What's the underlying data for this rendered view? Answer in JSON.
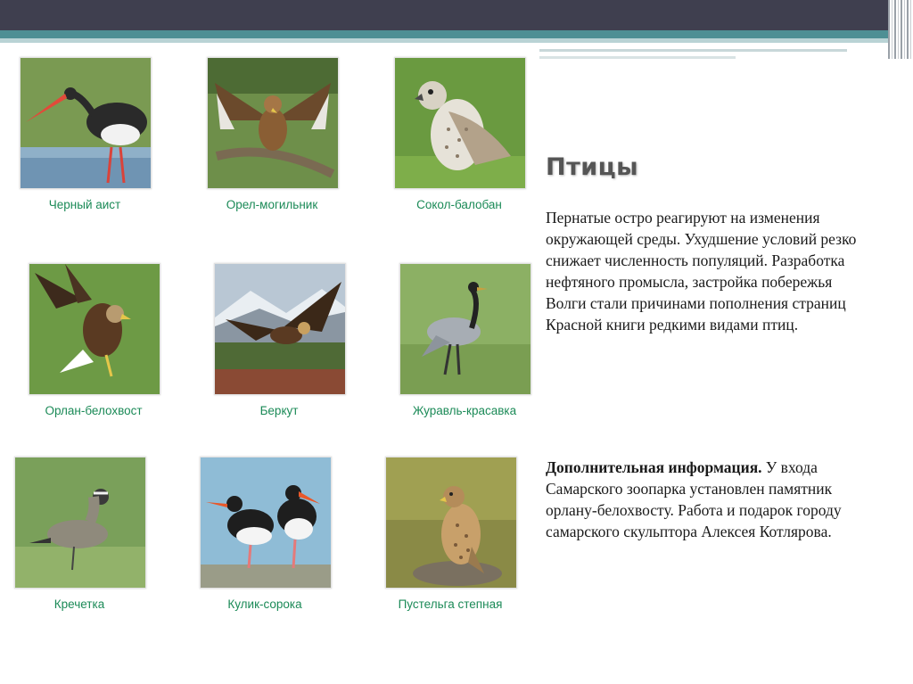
{
  "slide": {
    "title": "Птицы",
    "paragraph_1": "Пернатые остро реагируют на изменения окружающей среды. Ухудшение условий резко снижает численность популяций. Разработка нефтяного промысла, застройка побережья Волги стали причинами пополнения страниц Красной книги редкими видами птиц.",
    "paragraph_2_lead": "Дополнительная информация.",
    "paragraph_2_rest": " У входа Самарского зоопарка установлен памятник орлану-белохвосту. Работа и подарок городу самарского скульптора Алексея Котлярова."
  },
  "gallery": [
    {
      "caption": "Черный аист",
      "icon": "black-stork-icon"
    },
    {
      "caption": "Орел-могильник",
      "icon": "imperial-eagle-icon"
    },
    {
      "caption": "Сокол-балобан",
      "icon": "saker-falcon-icon"
    },
    {
      "caption": "Орлан-белохвост",
      "icon": "white-tailed-eagle-icon"
    },
    {
      "caption": "Беркут",
      "icon": "golden-eagle-icon"
    },
    {
      "caption": "Журавль-красавка",
      "icon": "demoiselle-crane-icon"
    },
    {
      "caption": "Кречетка",
      "icon": "sociable-lapwing-icon"
    },
    {
      "caption": "Кулик-сорока",
      "icon": "oystercatcher-icon"
    },
    {
      "caption": "Пустельга степная",
      "icon": "lesser-kestrel-icon"
    }
  ],
  "colors": {
    "caption": "#1b8a57",
    "banner_dark": "#3f3f4f",
    "banner_teal": "#4e8f94"
  }
}
